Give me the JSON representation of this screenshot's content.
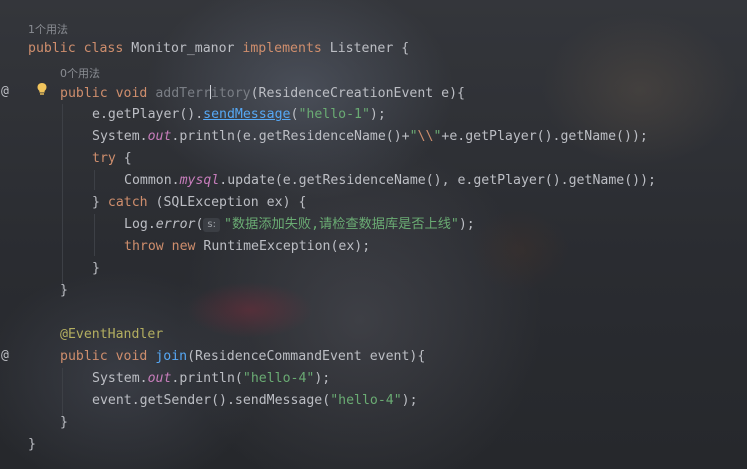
{
  "usages": {
    "class_usage": "1个用法",
    "method_usage": "0个用法"
  },
  "gutter": {
    "override_marker": "@"
  },
  "code": {
    "class_decl": {
      "kw_public": "public",
      "kw_class": "class",
      "name": "Monitor_manor",
      "kw_implements": "implements",
      "iface": "Listener",
      "brace": "{"
    },
    "method1": {
      "kw_public": "public",
      "kw_void": "void",
      "name_a": "addTerr",
      "name_b": "itory",
      "params": "(ResidenceCreationEvent e){"
    },
    "l_getplayer": {
      "pre": "e.getPlayer().",
      "call": "sendMessage",
      "open": "(",
      "str": "\"hello-1\"",
      "close": ");"
    },
    "l_println1": {
      "a": "System.",
      "out": "out",
      "b": ".println(e.getResidenceName()+",
      "q1": "\"",
      "esc": "\\\\",
      "q2": "\"",
      "c": "+e.getPlayer().getName());"
    },
    "l_try": {
      "kw": "try",
      "brace": " {"
    },
    "l_update": {
      "a": "Common.",
      "mysql": "mysql",
      "b": ".update(e.getResidenceName(), e.getPlayer().getName());"
    },
    "l_catch": {
      "brace": "} ",
      "kw": "catch",
      "rest": " (SQLException ex) {"
    },
    "l_log": {
      "a": "Log.",
      "error": "error",
      "open": "(",
      "hint": "s:",
      "str": "\"数据添加失败,请检查数据库是否上线\"",
      "close": ");"
    },
    "l_throw": {
      "kw1": "throw",
      "kw2": "new",
      "rest": " RuntimeException(ex);"
    },
    "l_close1": "}",
    "l_close2": "}",
    "annotation": "@EventHandler",
    "method2": {
      "kw_public": "public",
      "kw_void": "void",
      "name": "join",
      "params": "(ResidenceCommandEvent event){"
    },
    "l_println2": {
      "a": "System.",
      "out": "out",
      "b": ".println(",
      "str": "\"hello-4\"",
      "c": ");"
    },
    "l_send": {
      "a": "event.getSender().sendMessage(",
      "str": "\"hello-4\"",
      "c": ");"
    },
    "l_close3": "}",
    "l_close4": "}"
  }
}
